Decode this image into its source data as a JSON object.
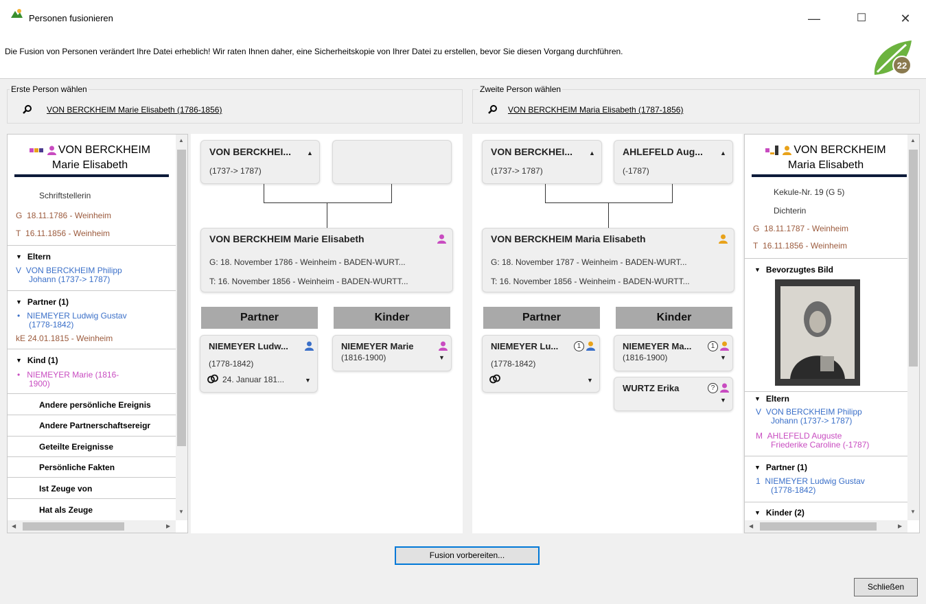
{
  "window": {
    "title": "Personen fusionieren",
    "minimize": "—",
    "maximize": "☐",
    "close": "✕"
  },
  "warning": "Die Fusion von Personen verändert Ihre Datei erheblich! Wir raten Ihnen daher, eine Sicherheitskopie von Ihrer Datei zu erstellen, bevor Sie diesen Vorgang durchführen.",
  "logo_text": "22",
  "first": {
    "label": "Erste Person wählen",
    "person": "VON BERCKHEIM Marie Elisabeth (1786-1856)"
  },
  "second": {
    "label": "Zweite Person wählen",
    "person": "VON BERCKHEIM Maria Elisabeth (1787-1856)"
  },
  "left_detail": {
    "name1": "VON BERCKHEIM",
    "name2": "Marie Elisabeth",
    "occupation": "Schriftstellerin",
    "birth_prefix": "G",
    "birth": "18.11.1786 - Weinheim",
    "death_prefix": "T",
    "death": "16.11.1856 - Weinheim",
    "parents_label": "Eltern",
    "father_prefix": "V",
    "father_l1": "VON BERCKHEIM Philipp",
    "father_l2": "Johann (1737-> 1787)",
    "partner_label": "Partner (1)",
    "partner_prefix": "•",
    "partner_l1": "NIEMEYER Ludwig Gustav",
    "partner_l2": "(1778-1842)",
    "marriage_prefix": "kE",
    "marriage": "24.01.1815 - Weinheim",
    "child_label": "Kind (1)",
    "child_prefix": "•",
    "child_l1": "NIEMEYER Marie (1816-",
    "child_l2": "1900)",
    "other1": "Andere persönliche Ereignis",
    "other2": "Andere Partnerschaftsereigr",
    "other3": "Geteilte Ereignisse",
    "other4": "Persönliche Fakten",
    "other5": "Ist Zeuge von",
    "other6": "Hat als Zeuge"
  },
  "right_detail": {
    "name1": "VON BERCKHEIM",
    "name2": "Maria Elisabeth",
    "kekule": "Kekule-Nr. 19 (G 5)",
    "occupation": "Dichterin",
    "birth_prefix": "G",
    "birth": "18.11.1787 - Weinheim",
    "death_prefix": "T",
    "death": "16.11.1856 - Weinheim",
    "image_label": "Bevorzugtes Bild",
    "parents_label": "Eltern",
    "father_prefix": "V",
    "father_l1": "VON BERCKHEIM Philipp",
    "father_l2": "Johann (1737-> 1787)",
    "mother_prefix": "M",
    "mother_l1": "AHLEFELD Auguste",
    "mother_l2": "Friederike Caroline (-1787)",
    "partner_label": "Partner (1)",
    "partner_prefix": "1",
    "partner_l1": "NIEMEYER Ludwig Gustav",
    "partner_l2": "(1778-1842)",
    "children_label": "Kinder (2)"
  },
  "tree1": {
    "father_name": "VON BERCKHEI...",
    "father_dates": "(1737-> 1787)",
    "main_name": "VON BERCKHEIM Marie Elisabeth",
    "main_birth": "G: 18. November 1786 - Weinheim - BADEN-WURT...",
    "main_death": "T: 16. November 1856 - Weinheim - BADEN-WURTT...",
    "partner_header": "Partner",
    "children_header": "Kinder",
    "partner_name": "NIEMEYER Ludw...",
    "partner_dates": "(1778-1842)",
    "marriage": "24. Januar 181...",
    "child_name": "NIEMEYER Marie",
    "child_dates": "(1816-1900)"
  },
  "tree2": {
    "father_name": "VON BERCKHEI...",
    "father_dates": "(1737-> 1787)",
    "mother_name": "AHLEFELD Aug...",
    "mother_dates": "(-1787)",
    "main_name": "VON BERCKHEIM Maria Elisabeth",
    "main_birth": "G: 18. November 1787 - Weinheim - BADEN-WURT...",
    "main_death": "T: 16. November 1856 - Weinheim - BADEN-WURTT...",
    "partner_header": "Partner",
    "children_header": "Kinder",
    "partner_name": "NIEMEYER Lu...",
    "partner_dates": "(1778-1842)",
    "partner_badge": "1",
    "child1_name": "NIEMEYER Ma...",
    "child1_dates": "(1816-1900)",
    "child1_badge": "1",
    "child2_name": "WURTZ Erika",
    "child2_badge": "?"
  },
  "buttons": {
    "prepare": "Fusion vorbereiten...",
    "close": "Schließen"
  },
  "colors": {
    "male": "#3a6fc8",
    "female": "#c84bc0",
    "female_alt": "#e8a21a",
    "rule": "#0d1b3a",
    "focus": "#0078d7"
  }
}
